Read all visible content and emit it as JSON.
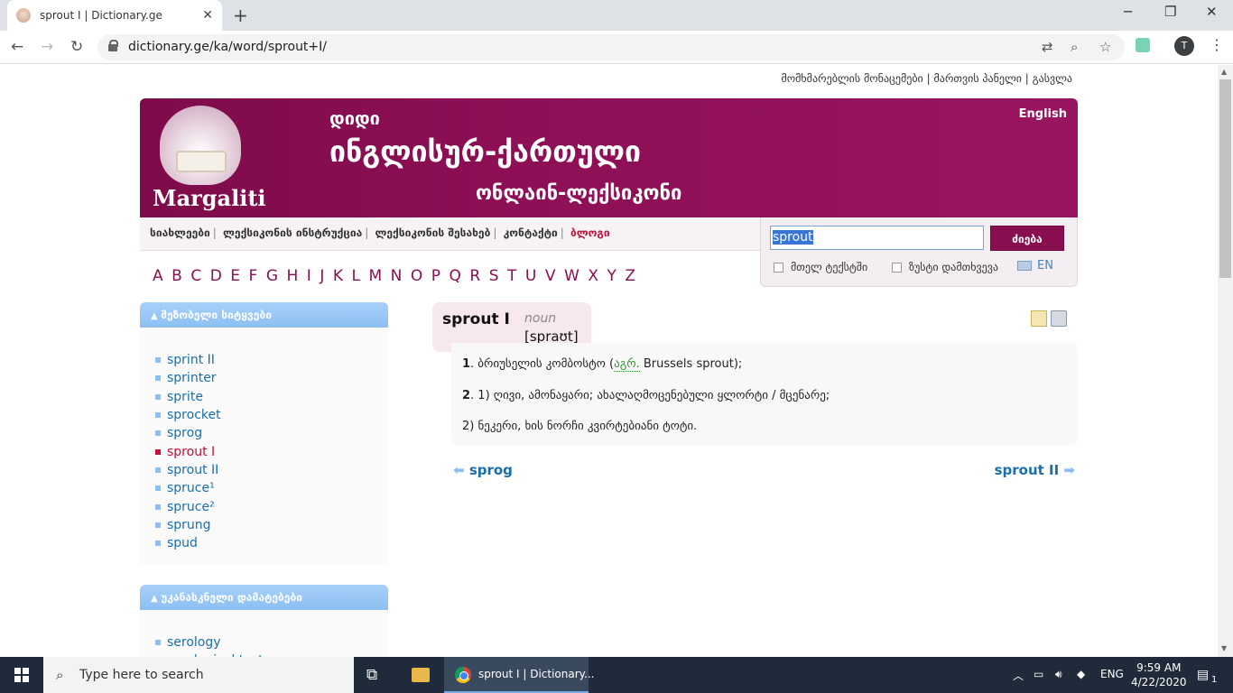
{
  "browser": {
    "tab_title": "sprout I | Dictionary.ge",
    "url": "dictionary.ge/ka/word/sprout+I/",
    "profile_initial": "T"
  },
  "toplinks": {
    "user_data": "მომხმარებლის მონაცემები",
    "admin_panel": "მართვის პანელი",
    "logout": "გასვლა"
  },
  "banner": {
    "brand": "Margaliti",
    "line1": "დიდი",
    "line2": "ინგლისურ-ქართული",
    "line3": "ონლაინ-ლექსიკონი",
    "lang_link": "English"
  },
  "menu": {
    "items": [
      "სიახლეები",
      "ლექსიკონის ინსტრუქცია",
      "ლექსიკონის შესახებ",
      "კონტაქტი"
    ],
    "blog": "ბლოგი"
  },
  "search": {
    "value": "sprout",
    "button": "ძიება",
    "opt_fulltext": "მთელ ტექსტში",
    "opt_exact": "ზუსტი დამთხვევა",
    "keyboard_lang": "EN"
  },
  "alphabet": [
    "A",
    "B",
    "C",
    "D",
    "E",
    "F",
    "G",
    "H",
    "I",
    "J",
    "K",
    "L",
    "M",
    "N",
    "O",
    "P",
    "Q",
    "R",
    "S",
    "T",
    "U",
    "V",
    "W",
    "X",
    "Y",
    "Z"
  ],
  "neighbors": {
    "title": "მეზობელი სიტყვები",
    "items": [
      "sprint II",
      "sprinter",
      "sprite",
      "sprocket",
      "sprog",
      "sprout I",
      "sprout II",
      "spruce¹",
      "spruce²",
      "sprung",
      "spud"
    ],
    "active": "sprout I"
  },
  "recent": {
    "title": "უკანასკნელი დამატებები",
    "items": [
      "serology",
      "serological test"
    ]
  },
  "entry": {
    "word": "sprout I",
    "pos": "noun",
    "ipa": "[spraʊt]",
    "def1_num": "1",
    "def1_text": ". ბრიუსელის კომბოსტო (",
    "def1_abbr": "აგრ.",
    "def1_tail": " Brussels sprout);",
    "def2_num": "2",
    "def2_text": ". 1) ღივი, ამონაყარი; ახალაღმოცენებული ყლორტი / მცენარე;",
    "def3_text": "2) ნეკერი, ხის ნორჩი კვირტებიანი ტოტი."
  },
  "pager": {
    "prev": "sprog",
    "next": "sprout II"
  },
  "taskbar": {
    "search_placeholder": "Type here to search",
    "chrome_label": "sprout I | Dictionary...",
    "lang": "ENG",
    "time": "9:59 AM",
    "date": "4/22/2020",
    "notif_count": "1"
  },
  "colors": {
    "brand": "#8a0f51",
    "link": "#1a6fa8",
    "active": "#c0113a",
    "sidebox_header": "#8cbff2"
  }
}
